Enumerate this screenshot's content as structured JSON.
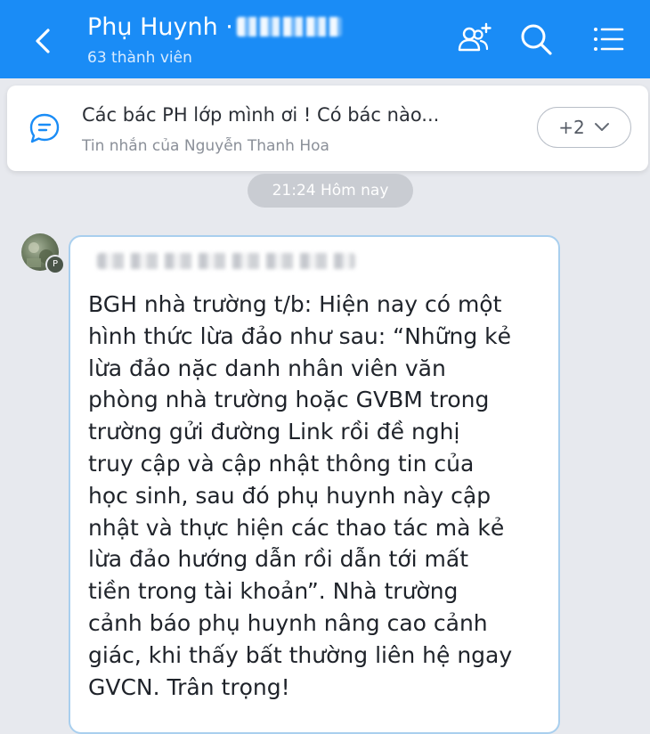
{
  "header": {
    "title": "Phụ Huynh ·",
    "members": "63 thành viên",
    "back_icon": "chevron-left-icon",
    "icons": [
      "add-member-icon",
      "search-icon",
      "menu-icon"
    ]
  },
  "pinned": {
    "message": "Các bác PH lớp mình ơi ! Có bác nào...",
    "sender_prefix": "Tin nhắn của Nguyễn Thanh Hoa",
    "more_count": "+2"
  },
  "time_badge": "21:24 Hôm nay",
  "message": {
    "lines": [
      "BGH nhà trường t/b: Hiện nay có một",
      "hình thức lừa đảo như sau: “Những kẻ",
      "lừa đảo nặc danh nhân viên văn",
      "phòng nhà trường hoặc GVBM trong",
      "trường gửi đường Link rồi đề nghị",
      "truy cập và cập nhật thông tin của",
      "học sinh, sau đó phụ huynh này cập",
      "nhật và thực hiện các thao tác mà kẻ",
      "lừa đảo hướng dẫn rồi dẫn tới mất",
      "tiền trong tài khoản”. Nhà trường",
      "cảnh báo phụ huynh nâng cao cảnh",
      "giác, khi thấy bất thường liên hệ ngay",
      "GVCN. Trân trọng!"
    ]
  },
  "colors": {
    "header_bg": "#1a8cf6",
    "bubble_border": "#a9cfee",
    "chat_bg": "#e7e9ee"
  }
}
